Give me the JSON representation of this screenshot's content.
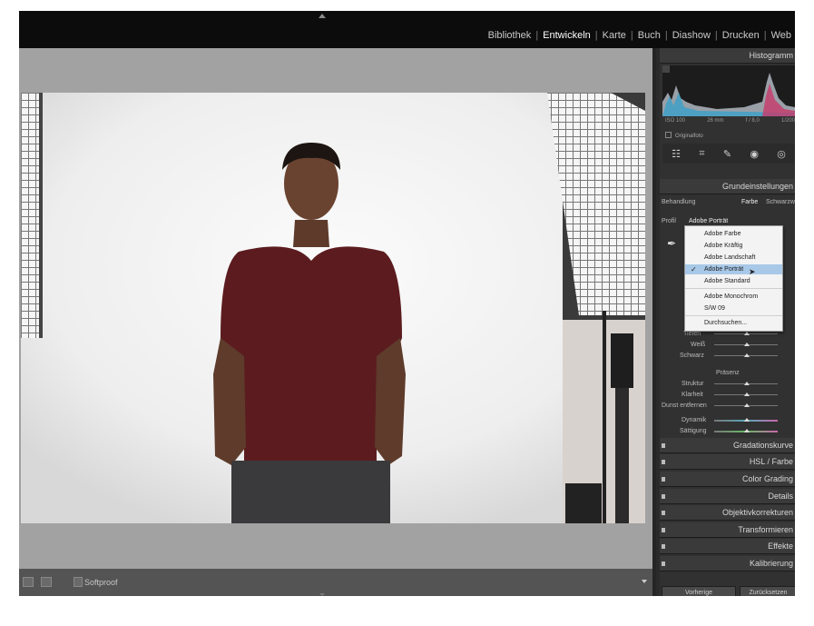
{
  "modules": [
    "Bibliothek",
    "Entwickeln",
    "Karte",
    "Buch",
    "Diashow",
    "Drucken",
    "Web"
  ],
  "active_module": "Entwickeln",
  "panels": {
    "histogram": {
      "title": "Histogramm",
      "iso": "ISO 100",
      "focal": "26 mm",
      "aperture": "f / 8,0",
      "shutter": "1/200",
      "original_photo_label": "Originalfoto"
    },
    "basic": {
      "title": "Grundeinstellungen",
      "treatment_label": "Behandlung",
      "treatment_color": "Farbe",
      "treatment_bw": "Schwarzweiß",
      "profile_label": "Profil",
      "profile_value": "Adobe Porträt"
    },
    "profile_menu": {
      "items": [
        "Adobe Farbe",
        "Adobe Kräftig",
        "Adobe Landschaft",
        "Adobe Porträt",
        "Adobe Standard"
      ],
      "selected": "Adobe Porträt",
      "extra": [
        "Adobe Monochrom",
        "S/W 09"
      ],
      "browse": "Durchsuchen..."
    },
    "tone_sliders": [
      "Tiefen",
      "Weiß",
      "Schwarz"
    ],
    "presence_title": "Präsenz",
    "presence_sliders": [
      "Struktur",
      "Klarheit",
      "Dunst entfernen"
    ],
    "color_sliders": [
      "Dynamik",
      "Sättigung"
    ],
    "collapsed": [
      "Gradationskurve",
      "HSL / Farbe",
      "Color Grading",
      "Details",
      "Objektivkorrekturen",
      "Transformieren",
      "Effekte",
      "Kalibrierung"
    ],
    "buttons": {
      "previous": "Vorherige",
      "reset": "Zurücksetzen"
    }
  },
  "toolbar": {
    "softproof": "Softproof"
  }
}
